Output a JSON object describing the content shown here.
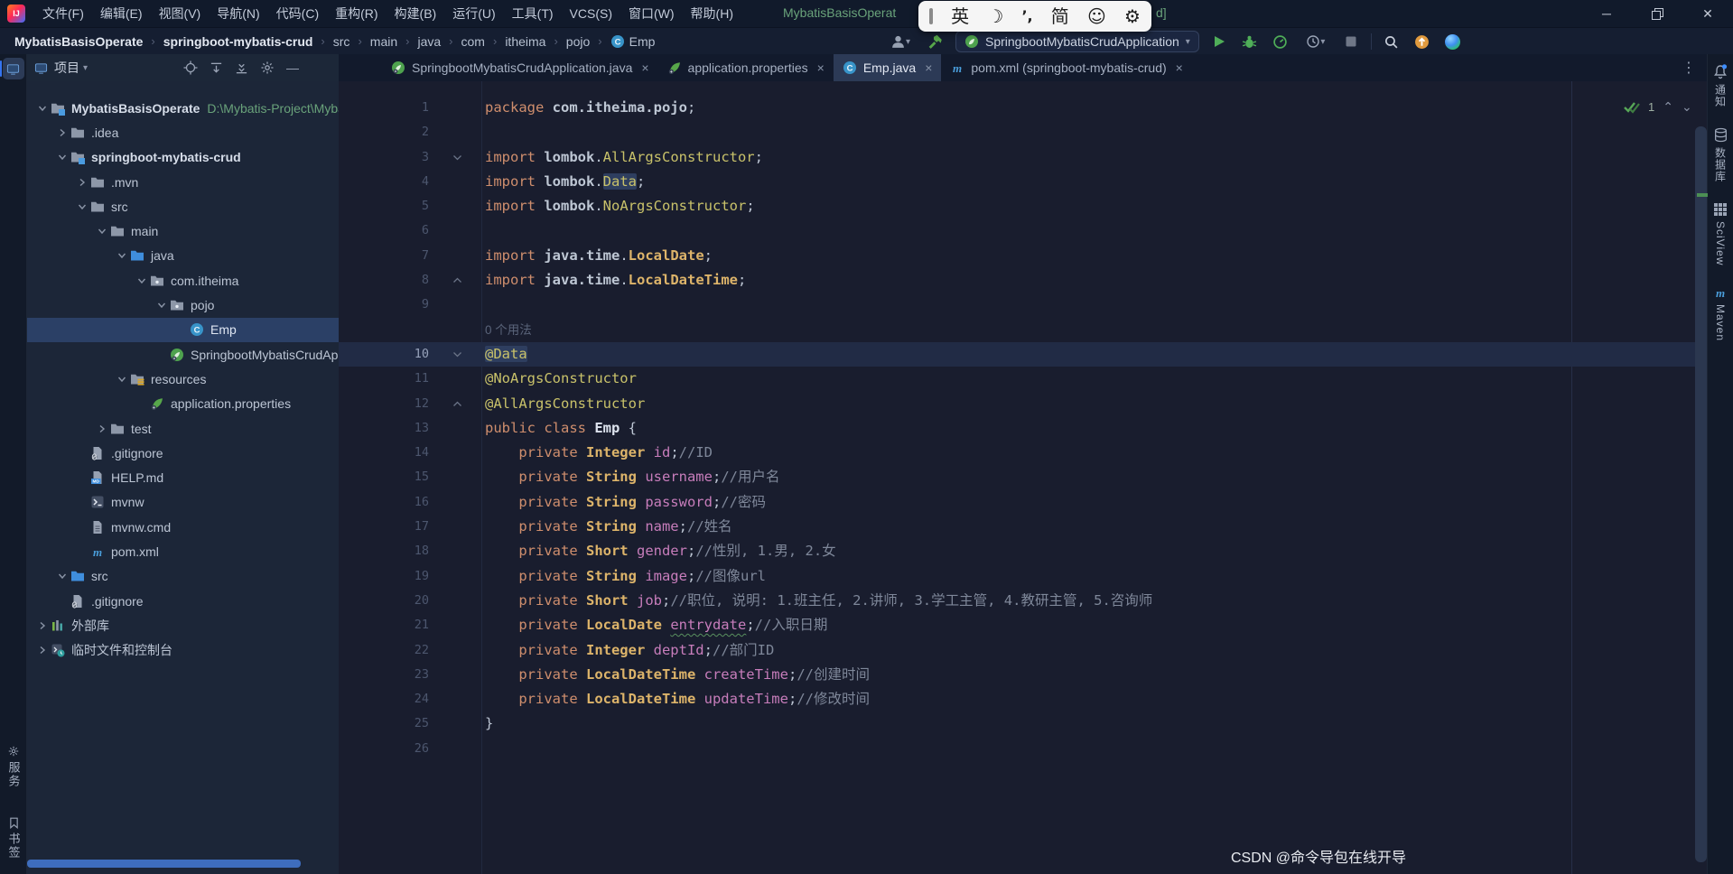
{
  "colors": {
    "accent_blue": "#3574f0",
    "run_green": "#4fae58",
    "spring_green": "#57a64a",
    "selection_blue": "#2b4066",
    "keyword_orange": "#cf8e6d",
    "type_yellow": "#ddb46a",
    "field_purple": "#c77dbb",
    "comment_gray": "#7e8799",
    "annotation_yellow": "#c9c26a",
    "title_green": "#69a27a"
  },
  "window": {
    "title_visible_left": "MybatisBasisOperat",
    "title_visible_right": "d]"
  },
  "menubar": {
    "items": [
      "文件(F)",
      "编辑(E)",
      "视图(V)",
      "导航(N)",
      "代码(C)",
      "重构(R)",
      "构建(B)",
      "运行(U)",
      "工具(T)",
      "VCS(S)",
      "窗口(W)",
      "帮助(H)"
    ]
  },
  "ime_popup": {
    "items": [
      "英",
      "☽",
      "’,",
      "简",
      "☺",
      "⚙"
    ]
  },
  "toolbar": {
    "breadcrumbs": [
      {
        "label": "MybatisBasisOperate",
        "bold": true
      },
      {
        "label": "springboot-mybatis-crud",
        "bold": true
      },
      {
        "label": "src"
      },
      {
        "label": "main"
      },
      {
        "label": "java"
      },
      {
        "label": "com"
      },
      {
        "label": "itheima"
      },
      {
        "label": "pojo"
      },
      {
        "label": "Emp",
        "icon": "class"
      }
    ],
    "run_config": "SpringbootMybatisCrudApplication"
  },
  "left_stripe": {
    "bottom_items": [
      {
        "label": "服务",
        "icon": "services"
      },
      {
        "label": "书签",
        "icon": "bookmark"
      }
    ]
  },
  "right_stripe": {
    "items": [
      {
        "label": "通知",
        "icon": "bell"
      },
      {
        "label": "数据库",
        "icon": "database"
      },
      {
        "label": "SciView",
        "icon": "grid"
      },
      {
        "label": "Maven",
        "icon": "maven"
      }
    ]
  },
  "project": {
    "header": "项目",
    "tree": [
      {
        "label": "MybatisBasisOperate",
        "level": 0,
        "chev": "open",
        "icon": "module",
        "bold": true,
        "path": "D:\\Mybatis-Project\\MybatisBa"
      },
      {
        "label": ".idea",
        "level": 1,
        "chev": "closed",
        "icon": "folder"
      },
      {
        "label": "springboot-mybatis-crud",
        "level": 1,
        "chev": "open",
        "icon": "module",
        "bold": true
      },
      {
        "label": ".mvn",
        "level": 2,
        "chev": "closed",
        "icon": "folder"
      },
      {
        "label": "src",
        "level": 2,
        "chev": "open",
        "icon": "folder"
      },
      {
        "label": "main",
        "level": 3,
        "chev": "open",
        "icon": "folder"
      },
      {
        "label": "java",
        "level": 4,
        "chev": "open",
        "icon": "folder-blue"
      },
      {
        "label": "com.itheima",
        "level": 5,
        "chev": "open",
        "icon": "package"
      },
      {
        "label": "pojo",
        "level": 6,
        "chev": "open",
        "icon": "package"
      },
      {
        "label": "Emp",
        "level": 7,
        "chev": "none",
        "icon": "class",
        "selected": true
      },
      {
        "label": "SpringbootMybatisCrudApplication",
        "level": 6,
        "chev": "none",
        "icon": "springboot"
      },
      {
        "label": "resources",
        "level": 4,
        "chev": "open",
        "icon": "resources"
      },
      {
        "label": "application.properties",
        "level": 5,
        "chev": "none",
        "icon": "leaf"
      },
      {
        "label": "test",
        "level": 3,
        "chev": "closed",
        "icon": "folder"
      },
      {
        "label": ".gitignore",
        "level": 2,
        "chev": "none",
        "icon": "gitfile"
      },
      {
        "label": "HELP.md",
        "level": 2,
        "chev": "none",
        "icon": "mdfile"
      },
      {
        "label": "mvnw",
        "level": 2,
        "chev": "none",
        "icon": "console"
      },
      {
        "label": "mvnw.cmd",
        "level": 2,
        "chev": "none",
        "icon": "textfile"
      },
      {
        "label": "pom.xml",
        "level": 2,
        "chev": "none",
        "icon": "maven"
      },
      {
        "label": "src",
        "level": 1,
        "chev": "open",
        "icon": "folder-blue"
      },
      {
        "label": ".gitignore",
        "level": 1,
        "chev": "none",
        "icon": "gitfile"
      },
      {
        "label": "外部库",
        "level": 0,
        "chev": "closed",
        "icon": "libs"
      },
      {
        "label": "临时文件和控制台",
        "level": 0,
        "chev": "closed",
        "icon": "scratch"
      }
    ]
  },
  "tabs": [
    {
      "label": "SpringbootMybatisCrudApplication.java",
      "icon": "springboot"
    },
    {
      "label": "application.properties",
      "icon": "leaf"
    },
    {
      "label": "Emp.java",
      "icon": "class",
      "active": true
    },
    {
      "label": "pom.xml (springboot-mybatis-crud)",
      "icon": "maven"
    }
  ],
  "editor": {
    "inspection_count": "1",
    "lines": [
      {
        "n": 1,
        "t": [
          [
            "kw",
            "package "
          ],
          [
            "pkg",
            "com.itheima.pojo"
          ],
          [
            "pln",
            ";"
          ]
        ]
      },
      {
        "n": 2,
        "t": []
      },
      {
        "n": 3,
        "fold": "open",
        "t": [
          [
            "kw",
            "import "
          ],
          [
            "pkg",
            "lombok"
          ],
          [
            "pln",
            "."
          ],
          [
            "ann",
            "AllArgsConstructor"
          ],
          [
            "pln",
            ";"
          ]
        ]
      },
      {
        "n": 4,
        "t": [
          [
            "kw",
            "import "
          ],
          [
            "pkg",
            "lombok"
          ],
          [
            "pln",
            "."
          ],
          [
            "ann hlbox",
            "Data"
          ],
          [
            "pln",
            ";"
          ]
        ]
      },
      {
        "n": 5,
        "t": [
          [
            "kw",
            "import "
          ],
          [
            "pkg",
            "lombok"
          ],
          [
            "pln",
            "."
          ],
          [
            "ann",
            "NoArgsConstructor"
          ],
          [
            "pln",
            ";"
          ]
        ]
      },
      {
        "n": 6,
        "t": []
      },
      {
        "n": 7,
        "t": [
          [
            "kw",
            "import "
          ],
          [
            "pkg",
            "java.time"
          ],
          [
            "pln",
            "."
          ],
          [
            "cls",
            "LocalDate"
          ],
          [
            "pln",
            ";"
          ]
        ]
      },
      {
        "n": 8,
        "fold": "close",
        "t": [
          [
            "kw",
            "import "
          ],
          [
            "pkg",
            "java.time"
          ],
          [
            "pln",
            "."
          ],
          [
            "cls",
            "LocalDateTime"
          ],
          [
            "pln",
            ";"
          ]
        ]
      },
      {
        "n": 9,
        "t": []
      },
      {
        "n": 10,
        "fold": "open",
        "caret": true,
        "inlay": "0 个用法",
        "t": [
          [
            "ann hlbox",
            "@Data"
          ]
        ]
      },
      {
        "n": 11,
        "t": [
          [
            "ann",
            "@NoArgsConstructor"
          ]
        ]
      },
      {
        "n": 12,
        "fold": "close",
        "t": [
          [
            "ann",
            "@AllArgsConstructor"
          ]
        ]
      },
      {
        "n": 13,
        "t": [
          [
            "kw",
            "public class "
          ],
          [
            "cls2",
            "Emp "
          ],
          [
            "pln",
            "{"
          ]
        ]
      },
      {
        "n": 14,
        "t": [
          [
            "pln",
            "    "
          ],
          [
            "kw",
            "private "
          ],
          [
            "cls",
            "Integer "
          ],
          [
            "fld",
            "id"
          ],
          [
            "pln",
            ";"
          ],
          [
            "cmt",
            "//ID"
          ]
        ]
      },
      {
        "n": 15,
        "t": [
          [
            "pln",
            "    "
          ],
          [
            "kw",
            "private "
          ],
          [
            "cls",
            "String "
          ],
          [
            "fld",
            "username"
          ],
          [
            "pln",
            ";"
          ],
          [
            "cmt",
            "//用户名"
          ]
        ]
      },
      {
        "n": 16,
        "t": [
          [
            "pln",
            "    "
          ],
          [
            "kw",
            "private "
          ],
          [
            "cls",
            "String "
          ],
          [
            "fld",
            "password"
          ],
          [
            "pln",
            ";"
          ],
          [
            "cmt",
            "//密码"
          ]
        ]
      },
      {
        "n": 17,
        "t": [
          [
            "pln",
            "    "
          ],
          [
            "kw",
            "private "
          ],
          [
            "cls",
            "String "
          ],
          [
            "fld",
            "name"
          ],
          [
            "pln",
            ";"
          ],
          [
            "cmt",
            "//姓名"
          ]
        ]
      },
      {
        "n": 18,
        "t": [
          [
            "pln",
            "    "
          ],
          [
            "kw",
            "private "
          ],
          [
            "cls",
            "Short "
          ],
          [
            "fld",
            "gender"
          ],
          [
            "pln",
            ";"
          ],
          [
            "cmt",
            "//性别, 1.男, 2.女"
          ]
        ]
      },
      {
        "n": 19,
        "t": [
          [
            "pln",
            "    "
          ],
          [
            "kw",
            "private "
          ],
          [
            "cls",
            "String "
          ],
          [
            "fld",
            "image"
          ],
          [
            "pln",
            ";"
          ],
          [
            "cmt",
            "//图像url"
          ]
        ]
      },
      {
        "n": 20,
        "t": [
          [
            "pln",
            "    "
          ],
          [
            "kw",
            "private "
          ],
          [
            "cls",
            "Short "
          ],
          [
            "fld",
            "job"
          ],
          [
            "pln",
            ";"
          ],
          [
            "cmt",
            "//职位, 说明: 1.班主任, 2.讲师, 3.学工主管, 4.教研主管, 5.咨询师"
          ]
        ]
      },
      {
        "n": 21,
        "t": [
          [
            "pln",
            "    "
          ],
          [
            "kw",
            "private "
          ],
          [
            "cls",
            "LocalDate "
          ],
          [
            "fld typo",
            "entrydate"
          ],
          [
            "pln",
            ";"
          ],
          [
            "cmt",
            "//入职日期"
          ]
        ]
      },
      {
        "n": 22,
        "t": [
          [
            "pln",
            "    "
          ],
          [
            "kw",
            "private "
          ],
          [
            "cls",
            "Integer "
          ],
          [
            "fld",
            "deptId"
          ],
          [
            "pln",
            ";"
          ],
          [
            "cmt",
            "//部门ID"
          ]
        ]
      },
      {
        "n": 23,
        "t": [
          [
            "pln",
            "    "
          ],
          [
            "kw",
            "private "
          ],
          [
            "cls",
            "LocalDateTime "
          ],
          [
            "fld",
            "createTime"
          ],
          [
            "pln",
            ";"
          ],
          [
            "cmt",
            "//创建时间"
          ]
        ]
      },
      {
        "n": 24,
        "t": [
          [
            "pln",
            "    "
          ],
          [
            "kw",
            "private "
          ],
          [
            "cls",
            "LocalDateTime "
          ],
          [
            "fld",
            "updateTime"
          ],
          [
            "pln",
            ";"
          ],
          [
            "cmt",
            "//修改时间"
          ]
        ]
      },
      {
        "n": 25,
        "t": [
          [
            "pln",
            "}"
          ]
        ]
      },
      {
        "n": 26,
        "t": []
      }
    ]
  },
  "glyphs": {
    "crumb_sep": "›",
    "tab_close": "×",
    "combo_arrow": "▾",
    "more": "⋮",
    "logo": "IJ",
    "minimize": "─"
  },
  "watermark": "CSDN @命令导包在线开导"
}
